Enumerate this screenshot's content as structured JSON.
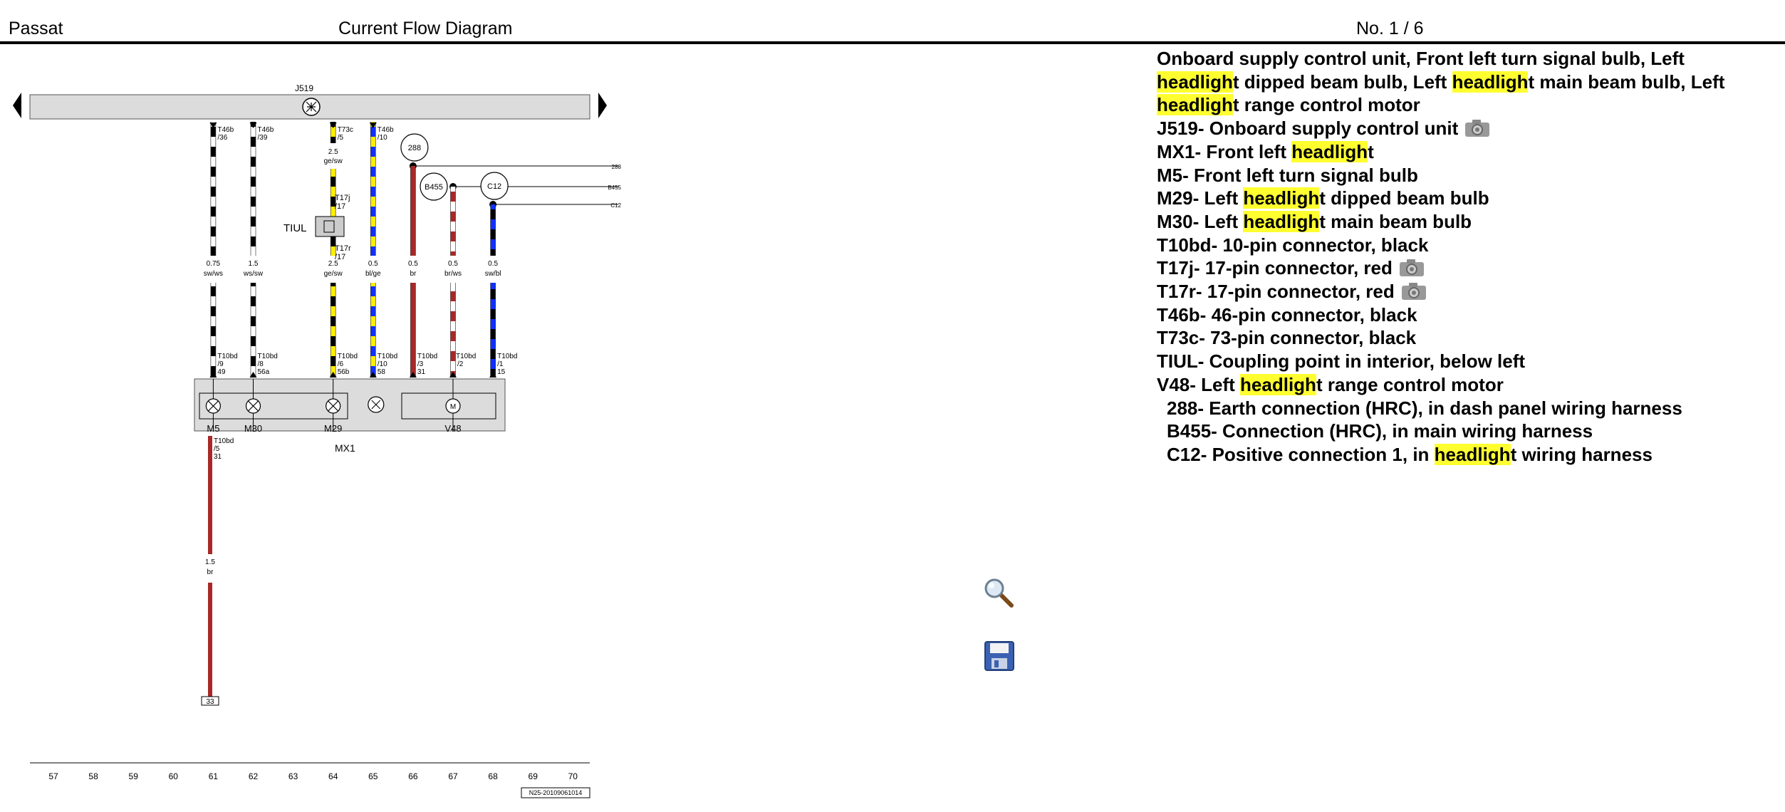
{
  "header": {
    "model": "Passat",
    "title": "Current Flow Diagram",
    "page": "No.  1 / 6"
  },
  "legend": {
    "title_parts": [
      {
        "t": "Onboard supply control unit, Front left turn signal bulb, Left ",
        "h": false
      },
      {
        "t": "headligh",
        "h": true
      },
      {
        "t": "t dipped beam bulb, Left ",
        "h": false
      },
      {
        "t": "headligh",
        "h": true
      },
      {
        "t": "t main beam bulb, Left ",
        "h": false
      },
      {
        "t": "headligh",
        "h": true
      },
      {
        "t": "t range control motor",
        "h": false
      }
    ],
    "items": [
      {
        "parts": [
          {
            "t": "J519-  Onboard supply control unit",
            "h": false
          }
        ],
        "camera": true
      },
      {
        "parts": [
          {
            "t": "MX1-  Front left ",
            "h": false
          },
          {
            "t": "headligh",
            "h": true
          },
          {
            "t": "t",
            "h": false
          }
        ]
      },
      {
        "parts": [
          {
            "t": "M5-  Front left turn signal bulb",
            "h": false
          }
        ]
      },
      {
        "parts": [
          {
            "t": "M29-  Left ",
            "h": false
          },
          {
            "t": "headligh",
            "h": true
          },
          {
            "t": "t dipped beam bulb",
            "h": false
          }
        ]
      },
      {
        "parts": [
          {
            "t": "M30-  Left ",
            "h": false
          },
          {
            "t": "headligh",
            "h": true
          },
          {
            "t": "t main beam bulb",
            "h": false
          }
        ]
      },
      {
        "parts": [
          {
            "t": "T10bd-  10-pin connector, black",
            "h": false
          }
        ]
      },
      {
        "parts": [
          {
            "t": "T17j-  17-pin connector, red",
            "h": false
          }
        ],
        "camera": true
      },
      {
        "parts": [
          {
            "t": "T17r-  17-pin connector, red",
            "h": false
          }
        ],
        "camera": true
      },
      {
        "parts": [
          {
            "t": "T46b-  46-pin connector, black",
            "h": false
          }
        ]
      },
      {
        "parts": [
          {
            "t": "T73c-  73-pin connector, black",
            "h": false
          }
        ]
      },
      {
        "parts": [
          {
            "t": "TIUL-  Coupling point in interior, below left",
            "h": false
          }
        ]
      },
      {
        "parts": [
          {
            "t": "V48-  Left ",
            "h": false
          },
          {
            "t": "headligh",
            "h": true
          },
          {
            "t": "t range control motor",
            "h": false
          }
        ]
      },
      {
        "parts": [
          {
            "t": "288-  Earth connection (HRC), in dash panel wiring harness",
            "h": false
          }
        ],
        "sub": true
      },
      {
        "parts": [
          {
            "t": "B455-  Connection (HRC), in main wiring harness",
            "h": false
          }
        ],
        "sub": true
      },
      {
        "parts": [
          {
            "t": "C12-  Positive connection 1, in ",
            "h": false
          },
          {
            "t": "headligh",
            "h": true
          },
          {
            "t": "t wiring harness",
            "h": false
          }
        ],
        "sub": true
      }
    ]
  },
  "diagram": {
    "bus_label": "J519",
    "wires": [
      {
        "col": 61,
        "top_pin": [
          "T46b",
          "/36"
        ],
        "spec": [
          "0.75",
          "sw/ws"
        ],
        "bottom_pin": [
          "T10bd",
          "/9",
          "49"
        ],
        "c1": "#000000",
        "c2": "#ffffff"
      },
      {
        "col": 62,
        "top_pin": [
          "T46b",
          "/39"
        ],
        "spec": [
          "1.5",
          "ws/sw"
        ],
        "bottom_pin": [
          "T10bd",
          "/8",
          "56a"
        ],
        "c1": "#ffffff",
        "c2": "#000000"
      },
      {
        "col": 64,
        "top_pin": [
          "T73c",
          "/5"
        ],
        "spec": [
          "2.5",
          "ge/sw"
        ],
        "spec2": [
          "2.5",
          "ge/sw"
        ],
        "bottom_pin": [
          "T10bd",
          "/6",
          "56b"
        ],
        "c1": "#ffee00",
        "c2": "#000000"
      },
      {
        "col": 65,
        "top_pin": [
          "T46b",
          "/10"
        ],
        "spec": [
          "0.5",
          "bl/ge"
        ],
        "bottom_pin": [
          "T10bd",
          "/10",
          "58"
        ],
        "c1": "#1030ff",
        "c2": "#ffee00"
      },
      {
        "col": 66,
        "spec": [
          "0.5",
          "br"
        ],
        "bottom_pin": [
          "T10bd",
          "/3",
          "31"
        ],
        "c1": "#a82828",
        "c2": "#a82828",
        "node": "288"
      },
      {
        "col": 67,
        "spec": [
          "0.5",
          "br/ws"
        ],
        "bottom_pin": [
          "T10bd",
          "/2"
        ],
        "c1": "#a82828",
        "c2": "#ffffff",
        "node": "B455"
      },
      {
        "col": 68,
        "spec": [
          "0.5",
          "sw/bl"
        ],
        "bottom_pin": [
          "T10bd",
          "/1",
          "15"
        ],
        "c1": "#000000",
        "c2": "#1030ff",
        "node": "C12"
      }
    ],
    "coupling": {
      "label": "TIUL",
      "upper": [
        "T17j",
        "/17"
      ],
      "lower": [
        "T17r",
        "/17"
      ]
    },
    "components": [
      {
        "label": "M5",
        "col": 61
      },
      {
        "label": "M30",
        "col": 62
      },
      {
        "label": "M29",
        "col": 64
      },
      {
        "label": "V48",
        "col": 67
      }
    ],
    "unit_label": "MX1",
    "earth_wire": {
      "pin": [
        "T10bd",
        "/5",
        "31"
      ],
      "spec": [
        "1.5",
        "br"
      ],
      "terminal": "33"
    },
    "columns": [
      "57",
      "58",
      "59",
      "60",
      "61",
      "62",
      "63",
      "64",
      "65",
      "66",
      "67",
      "68",
      "69",
      "70"
    ],
    "doc_code": "N25-20109061014"
  },
  "tools": {
    "zoom": "magnifier-icon",
    "save": "floppy-disk-icon"
  }
}
